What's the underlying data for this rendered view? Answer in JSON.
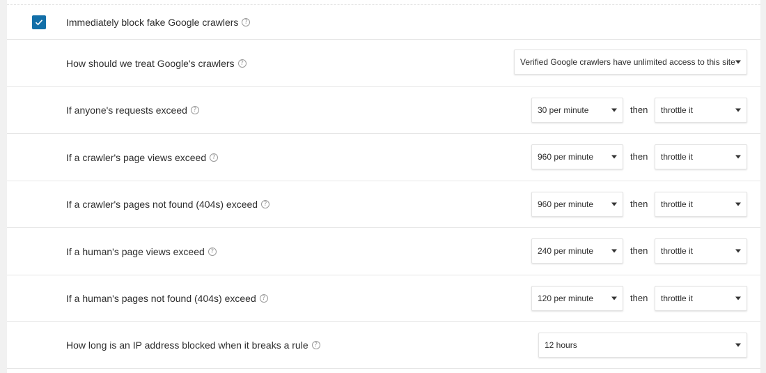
{
  "rows": {
    "block_fake": {
      "label": "Immediately block fake Google crawlers",
      "checked": true,
      "check_icon": "checkmark-icon"
    },
    "google_crawlers": {
      "label": "How should we treat Google's crawlers",
      "select": "Verified Google crawlers have unlimited access to this site"
    },
    "anyone_requests": {
      "label": "If anyone's requests exceed",
      "rate": "30 per minute",
      "then": "then",
      "action": "throttle it"
    },
    "crawler_views": {
      "label": "If a crawler's page views exceed",
      "rate": "960 per minute",
      "then": "then",
      "action": "throttle it"
    },
    "crawler_404": {
      "label": "If a crawler's pages not found (404s) exceed",
      "rate": "960 per minute",
      "then": "then",
      "action": "throttle it"
    },
    "human_views": {
      "label": "If a human's page views exceed",
      "rate": "240 per minute",
      "then": "then",
      "action": "throttle it"
    },
    "human_404": {
      "label": "If a human's pages not found (404s) exceed",
      "rate": "120 per minute",
      "then": "then",
      "action": "throttle it"
    },
    "block_duration": {
      "label": "How long is an IP address blocked when it breaks a rule",
      "select": "12 hours"
    }
  },
  "help_glyph": "?",
  "colors": {
    "accent": "#126fa8",
    "divider": "#e6e6e6",
    "background": "#f1f1f1"
  }
}
